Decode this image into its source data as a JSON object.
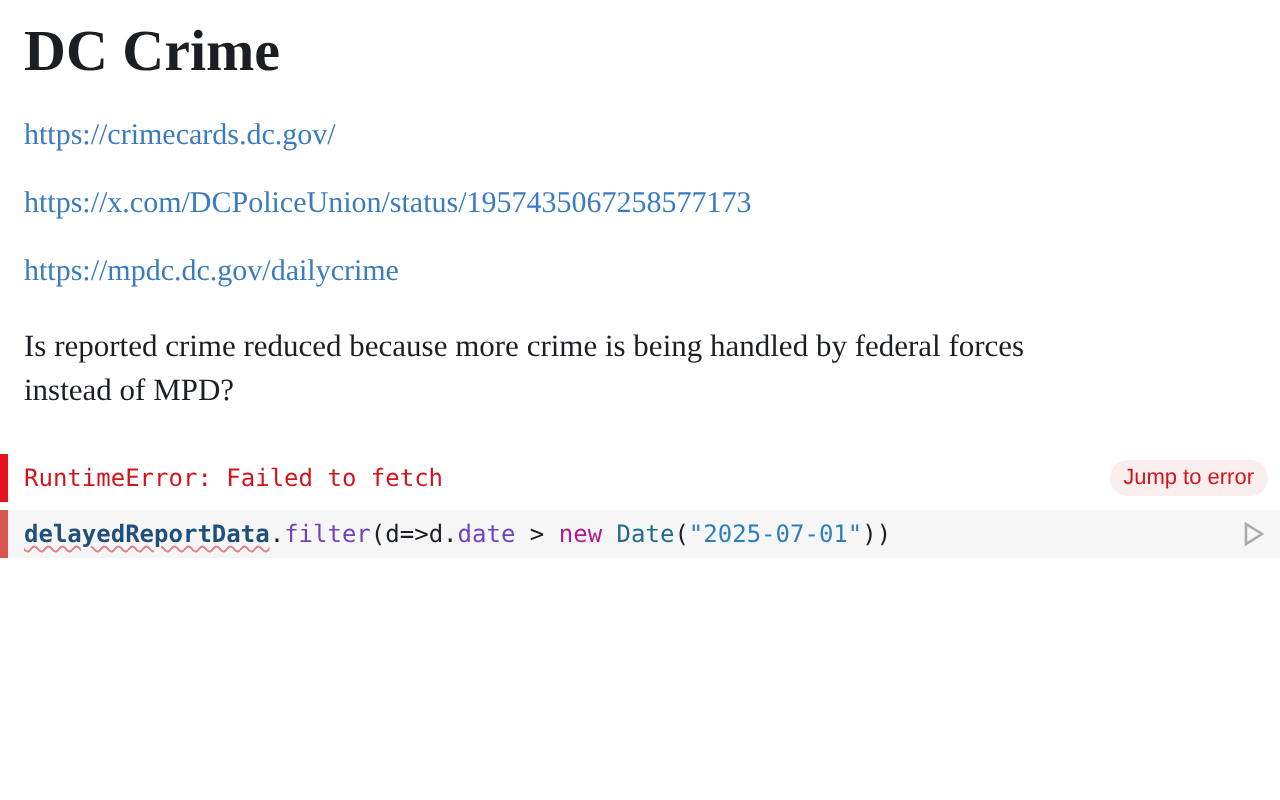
{
  "title": "DC Crime",
  "links": [
    "https://crimecards.dc.gov/",
    "https://x.com/DCPoliceUnion/status/1957435067258577173",
    "https://mpdc.dc.gov/dailycrime"
  ],
  "paragraph": "Is reported crime reduced because more crime is being handled by federal forces instead of MPD?",
  "error": {
    "message": "RuntimeError: Failed to fetch",
    "button": "Jump to error"
  },
  "code": [
    {
      "kind": "variable",
      "text": "delayedReportData"
    },
    {
      "kind": "plain",
      "text": "."
    },
    {
      "kind": "method",
      "text": "filter"
    },
    {
      "kind": "plain",
      "text": "(d=>d."
    },
    {
      "kind": "method",
      "text": "date"
    },
    {
      "kind": "plain",
      "text": " > "
    },
    {
      "kind": "keyword",
      "text": "new "
    },
    {
      "kind": "builtin",
      "text": "Date"
    },
    {
      "kind": "plain",
      "text": "("
    },
    {
      "kind": "string",
      "text": "\"2025-07-01\""
    },
    {
      "kind": "plain",
      "text": "))"
    }
  ]
}
